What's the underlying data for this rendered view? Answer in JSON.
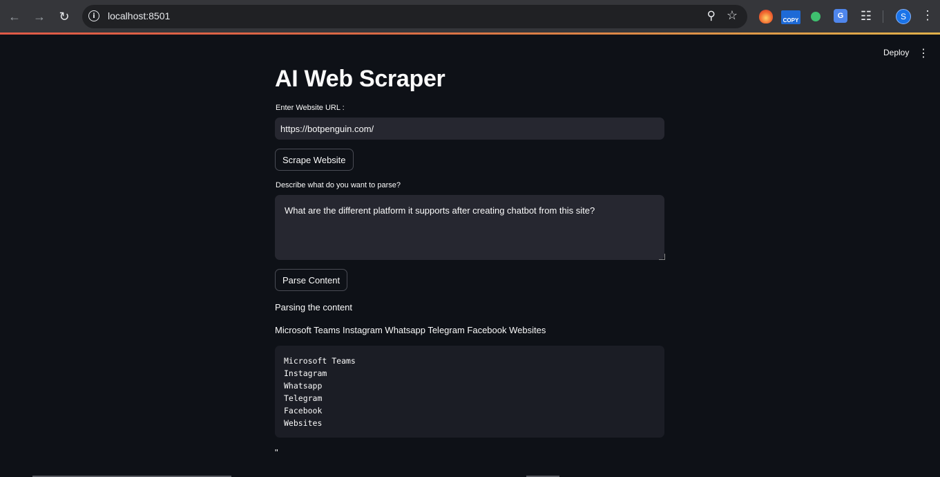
{
  "browser": {
    "url": "localhost:8501",
    "copy_badge": "COPY",
    "translate_badge": "G",
    "profile_initial": "S"
  },
  "app_header": {
    "deploy_label": "Deploy"
  },
  "main": {
    "title": "AI Web Scraper",
    "url_label": "Enter Website URL :",
    "url_value": "https://botpenguin.com/",
    "scrape_button": "Scrape Website",
    "parse_label": "Describe what do you want to parse?",
    "parse_value": "What are the different platform it supports after creating chatbot from this site?",
    "parse_button": "Parse Content",
    "status_text": "Parsing the content",
    "result_inline": "Microsoft Teams Instagram Whatsapp Telegram Facebook Websites",
    "result_lines": [
      "Microsoft Teams",
      "Instagram",
      "Whatsapp",
      "Telegram",
      "Facebook",
      "Websites"
    ],
    "trailing_text": "\""
  },
  "colors": {
    "background": "#0e1117",
    "input_bg": "#262730",
    "code_bg": "#1b1d25",
    "text": "#fafafa"
  }
}
